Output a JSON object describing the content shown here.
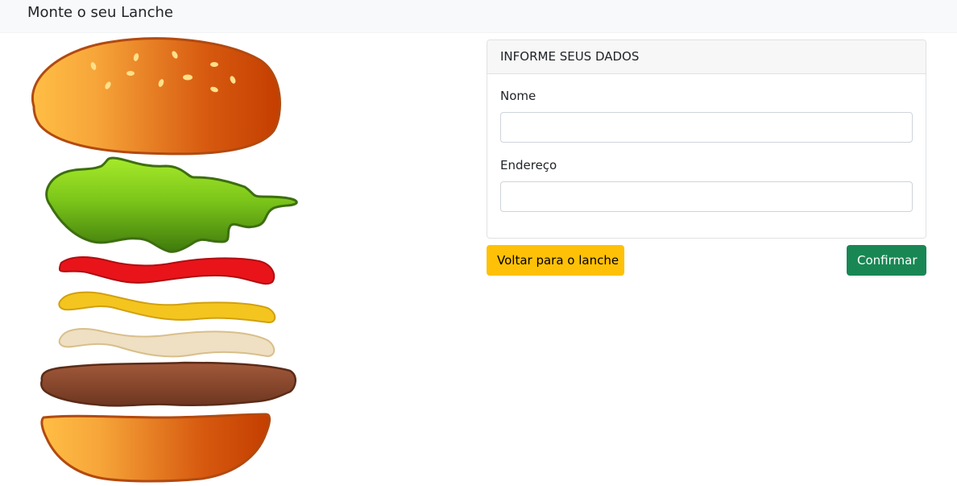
{
  "navbar": {
    "brand": "Monte o seu Lanche"
  },
  "form": {
    "header": "INFORME SEUS DADOS",
    "name_label": "Nome",
    "name_value": "",
    "address_label": "Endereço",
    "address_value": ""
  },
  "actions": {
    "back_label": "Voltar para o lanche",
    "confirm_label": "Confirmar"
  },
  "colors": {
    "back_button": "#ffc107",
    "confirm_button": "#198754",
    "bun_light": "#ffbe45",
    "bun_dark": "#c94000",
    "lettuce": "#7cc61a",
    "ketchup": "#e8141a",
    "mustard": "#f4c51e",
    "mayo": "#efdfc3",
    "patty": "#8b4a2b"
  }
}
